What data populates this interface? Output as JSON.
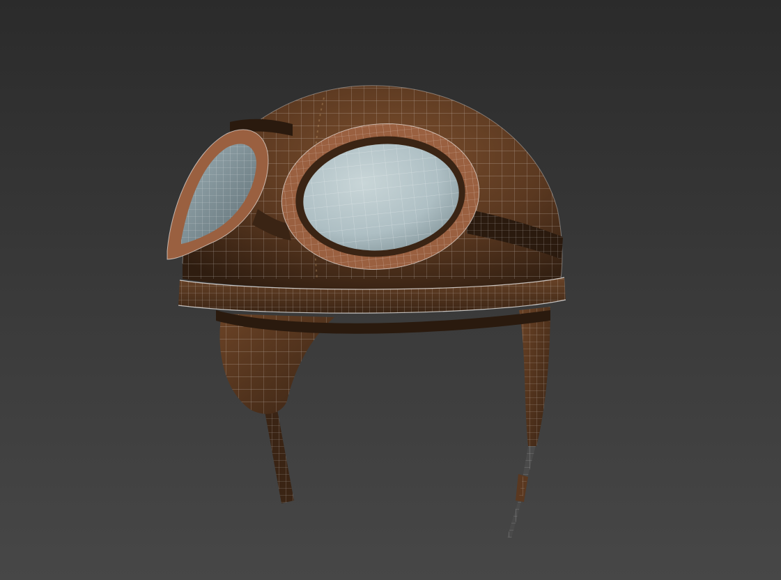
{
  "viewport": {
    "background_top": "#2b2b2b",
    "background_bottom": "#474747"
  },
  "model": {
    "leather_color": "#5a3820",
    "leather_dark": "#2f1d10",
    "leather_light": "#7a4e2d",
    "goggle_rim_color": "#9a6040",
    "lens_color": "#aebfc4",
    "wire_color": "#ffffff"
  }
}
